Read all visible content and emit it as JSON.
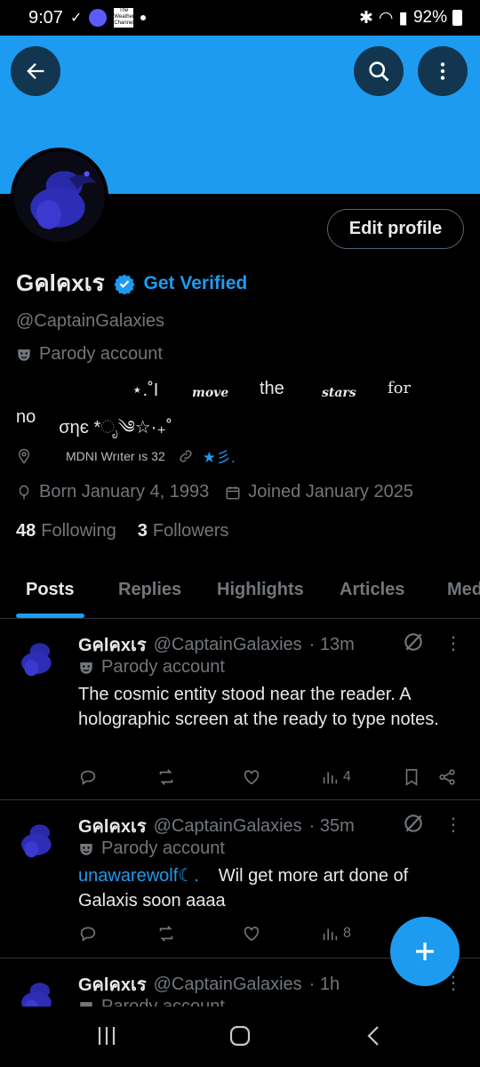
{
  "status_bar": {
    "time": "9:07",
    "battery": "92%",
    "weather_app_label": "The Weather Channel"
  },
  "header": {
    "banner_color": "#1d9bf0",
    "back_icon": "arrow-left-icon",
    "search_icon": "search-icon",
    "more_icon": "more-vertical-icon"
  },
  "profile": {
    "edit_label": "Edit profile",
    "display_name": "Gคlคxเร",
    "get_verified": "Get Verified",
    "handle": "@CaptainGalaxies",
    "parody_label": "Parody account",
    "bio_line1": {
      "a": "⋆.˚I",
      "b": "move",
      "c": "the",
      "d": "stars",
      "e": "for"
    },
    "bio_line2": {
      "a": "no",
      "b": "σηє *ೃ༄☆·₊˚"
    },
    "location": "MDNI Wrıter ıs 32",
    "link_text": "★彡.",
    "born": "Born January 4, 1993",
    "joined": "Joined January 2025",
    "following_count": "48",
    "following_label": "Following",
    "followers_count": "3",
    "followers_label": "Followers"
  },
  "tabs": [
    "Posts",
    "Replies",
    "Highlights",
    "Articles",
    "Media"
  ],
  "active_tab": "Posts",
  "posts": [
    {
      "name": "Gคlคxเร",
      "handle": "@CaptainGalaxies",
      "time": "· 13m",
      "parody": "Parody account",
      "mention": "",
      "text": "The cosmic entity stood near the reader. A holographic screen at the ready to type notes.",
      "views": "4"
    },
    {
      "name": "Gคlคxเร",
      "handle": "@CaptainGalaxies",
      "time": "· 35m",
      "parody": "Parody account",
      "mention": "unawarewolf☾.",
      "text": "Wil get more art done of Galaxis soon aaaa",
      "views": "8"
    },
    {
      "name": "Gคlคxเร",
      "handle": "@CaptainGalaxies",
      "time": "· 1h",
      "parody": "Parody account"
    }
  ],
  "colors": {
    "accent": "#1d9bf0",
    "muted": "#71767b",
    "text": "#e7e9ea"
  }
}
